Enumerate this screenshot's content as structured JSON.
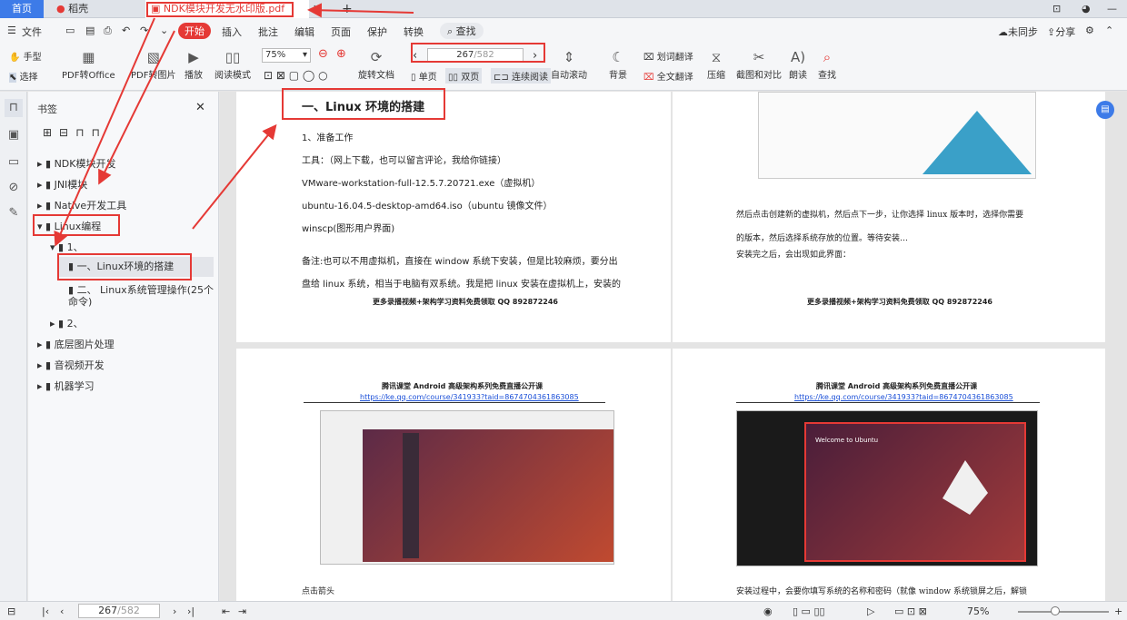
{
  "tabs": {
    "home": "首页",
    "app": "稻壳",
    "doc": "NDK模块开发无水印版.pdf"
  },
  "menu": {
    "file": "文件",
    "items": [
      "开始",
      "插入",
      "批注",
      "编辑",
      "页面",
      "保护",
      "转换"
    ],
    "search": "查找",
    "sync": "未同步",
    "share": "分享"
  },
  "toolbar": {
    "hand": "手型",
    "select": "选择",
    "pdf2office": "PDF转Office",
    "pdf2img": "PDF转图片",
    "play": "播放",
    "readmode": "阅读模式",
    "zoom": "75%",
    "rotate": "旋转文档",
    "page_current": "267",
    "page_total": "/582",
    "single": "单页",
    "double": "双页",
    "continuous": "连续阅读",
    "autoscroll": "自动滚动",
    "bg": "背景",
    "wordtrans": "划词翻译",
    "fulltrans": "全文翻译",
    "compress": "压缩",
    "screenshot": "截图和对比",
    "read": "朗读",
    "find": "查找"
  },
  "bookmarks": {
    "title": "书签",
    "items": [
      "NDK模块开发",
      "JNI模块",
      "Native开发工具",
      "Linux编程",
      "1、",
      "一、Linux环境的搭建",
      "二、 Linux系统管理操作(25个命令)",
      "2、",
      "底层图片处理",
      "音视频开发",
      "机器学习"
    ]
  },
  "page1": {
    "heading": "一、Linux 环境的搭建",
    "l1": "1、准备工作",
    "l2": "工具：（网上下载，也可以留言评论，我给你链接）",
    "l3": "VMware-workstation-full-12.5.7.20721.exe（虚拟机）",
    "l4": "ubuntu-16.04.5-desktop-amd64.iso（ubuntu 镜像文件）",
    "l5": "winscp(图形用户界面)",
    "l6": "备注:也可以不用虚拟机，直接在 window 系统下安装，但是比较麻烦，要分出",
    "l7": "盘给 linux 系统，相当于电脑有双系统。我是把 linux 安装在虚拟机上，安装的",
    "footer": "更多录播视频+架构学习资料免费领取 QQ 892872246"
  },
  "page2": {
    "l1": "然后点击创建新的虚拟机，然后点下一步，让你选择 linux 版本时，选择你需要",
    "l2": "的版本，然后选择系统存放的位置。等待安装…",
    "l3": "安装完之后，会出现如此界面：",
    "footer": "更多录播视频+架构学习资料免费领取 QQ 892872246"
  },
  "page3": {
    "h1": "腾讯课堂 Android 高级架构系列免费直播公开课",
    "link": "https://ke.qq.com/course/341933?taid=8674704361863085",
    "caption": "点击箭头"
  },
  "page4": {
    "h1": "腾讯课堂 Android 高级架构系列免费直播公开课",
    "link": "https://ke.qq.com/course/341933?taid=8674704361863085",
    "welcome": "Welcome to Ubuntu",
    "caption": "安装过程中，会要你填写系统的名称和密码（就像 window 系统锁屏之后，解锁"
  },
  "status": {
    "page_current": "267",
    "page_total": "/582",
    "zoom": "75%"
  }
}
